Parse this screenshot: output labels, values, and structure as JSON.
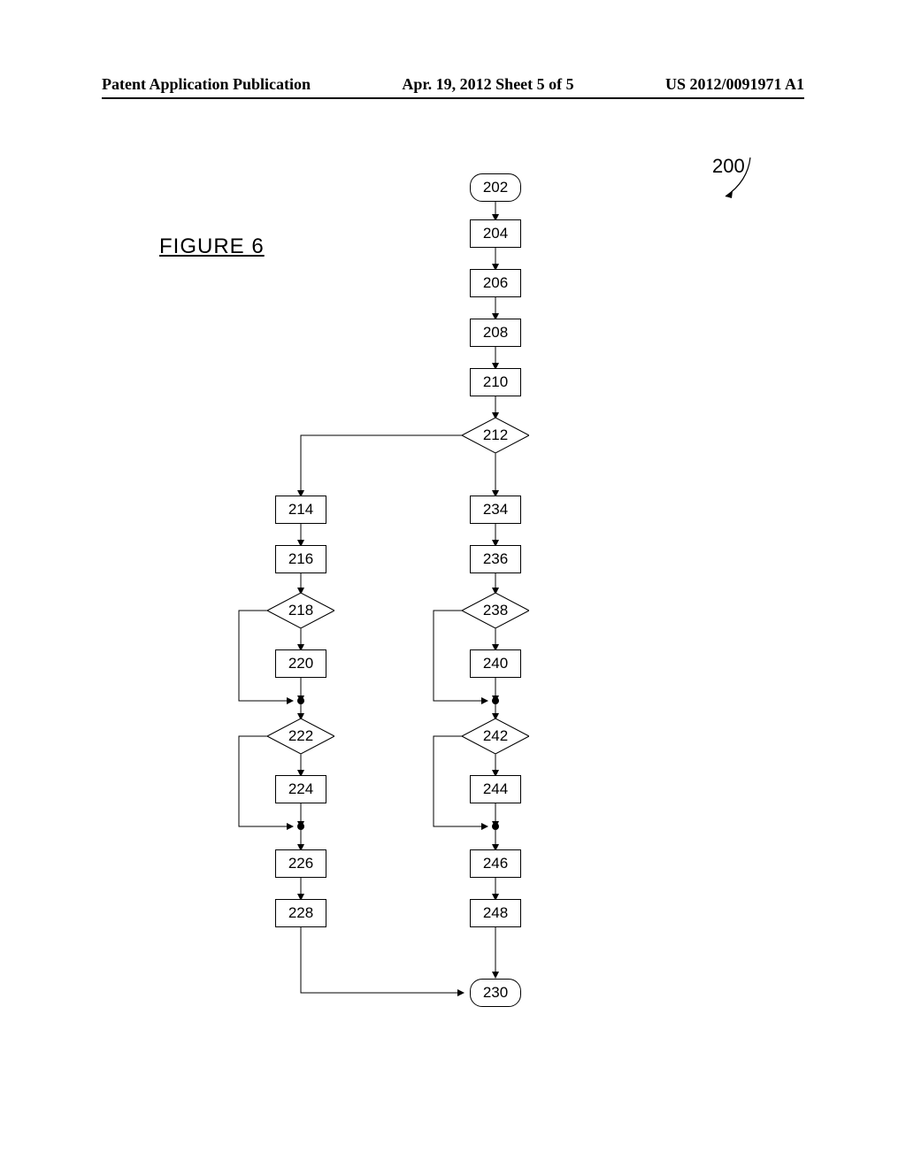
{
  "header": {
    "left": "Patent Application Publication",
    "center": "Apr. 19, 2012  Sheet 5 of 5",
    "right": "US 2012/0091971 A1"
  },
  "figure_label": "FIGURE  6",
  "reference_number": "200",
  "nodes": {
    "n202": "202",
    "n204": "204",
    "n206": "206",
    "n208": "208",
    "n210": "210",
    "n212": "212",
    "n214": "214",
    "n216": "216",
    "n218": "218",
    "n220": "220",
    "n222": "222",
    "n224": "224",
    "n226": "226",
    "n228": "228",
    "n230": "230",
    "n234": "234",
    "n236": "236",
    "n238": "238",
    "n240": "240",
    "n242": "242",
    "n244": "244",
    "n246": "246",
    "n248": "248"
  }
}
